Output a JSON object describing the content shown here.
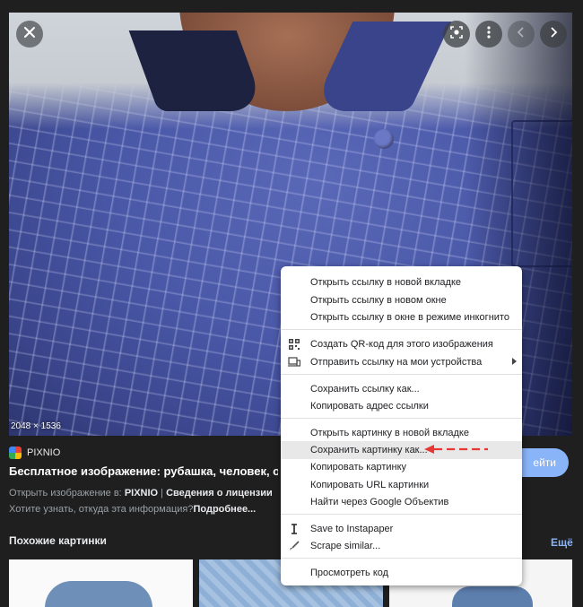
{
  "image": {
    "dimensions": "2048 × 1536"
  },
  "controls": {
    "close": "close-icon",
    "lens": "lens-icon",
    "more": "more-vert-icon",
    "prev": "chevron-left-icon",
    "next": "chevron-right-icon"
  },
  "source": {
    "name": "PIXNIO",
    "title": "Бесплатное изображение: рубашка, человек, одеж",
    "visit_label": "ейти",
    "open_prefix": "Открыть изображение в: ",
    "open_site": "PIXNIO",
    "separator": " | ",
    "license": "Сведения о лицензии",
    "info_question": "Хотите узнать, откуда эта информация?",
    "info_more": "Подробнее..."
  },
  "similar": {
    "heading": "Похожие картинки",
    "more": "Ещё"
  },
  "context_menu": {
    "items": [
      {
        "label": "Открыть ссылку в новой вкладке"
      },
      {
        "label": "Открыть ссылку в новом окне"
      },
      {
        "label": "Открыть ссылку в окне в режиме инкогнито"
      },
      {
        "label": "Создать QR-код для этого изображения",
        "icon": "qr-code-icon"
      },
      {
        "label": "Отправить ссылку на мои устройства",
        "icon": "devices-icon"
      },
      {
        "label": "Сохранить ссылку как..."
      },
      {
        "label": "Копировать адрес ссылки"
      },
      {
        "label": "Открыть картинку в новой вкладке"
      },
      {
        "label": "Сохранить картинку как..."
      },
      {
        "label": "Копировать картинку"
      },
      {
        "label": "Копировать URL картинки"
      },
      {
        "label": "Найти через Google Объектив"
      },
      {
        "label": "Save to Instapaper",
        "icon": "instapaper-icon"
      },
      {
        "label": "Scrape similar...",
        "icon": "scraper-icon"
      },
      {
        "label": "Просмотреть код"
      }
    ],
    "highlighted_item": "Сохранить картинку как..."
  },
  "colors": {
    "accent": "#8ab4f8",
    "annotation_arrow": "#e53935"
  }
}
